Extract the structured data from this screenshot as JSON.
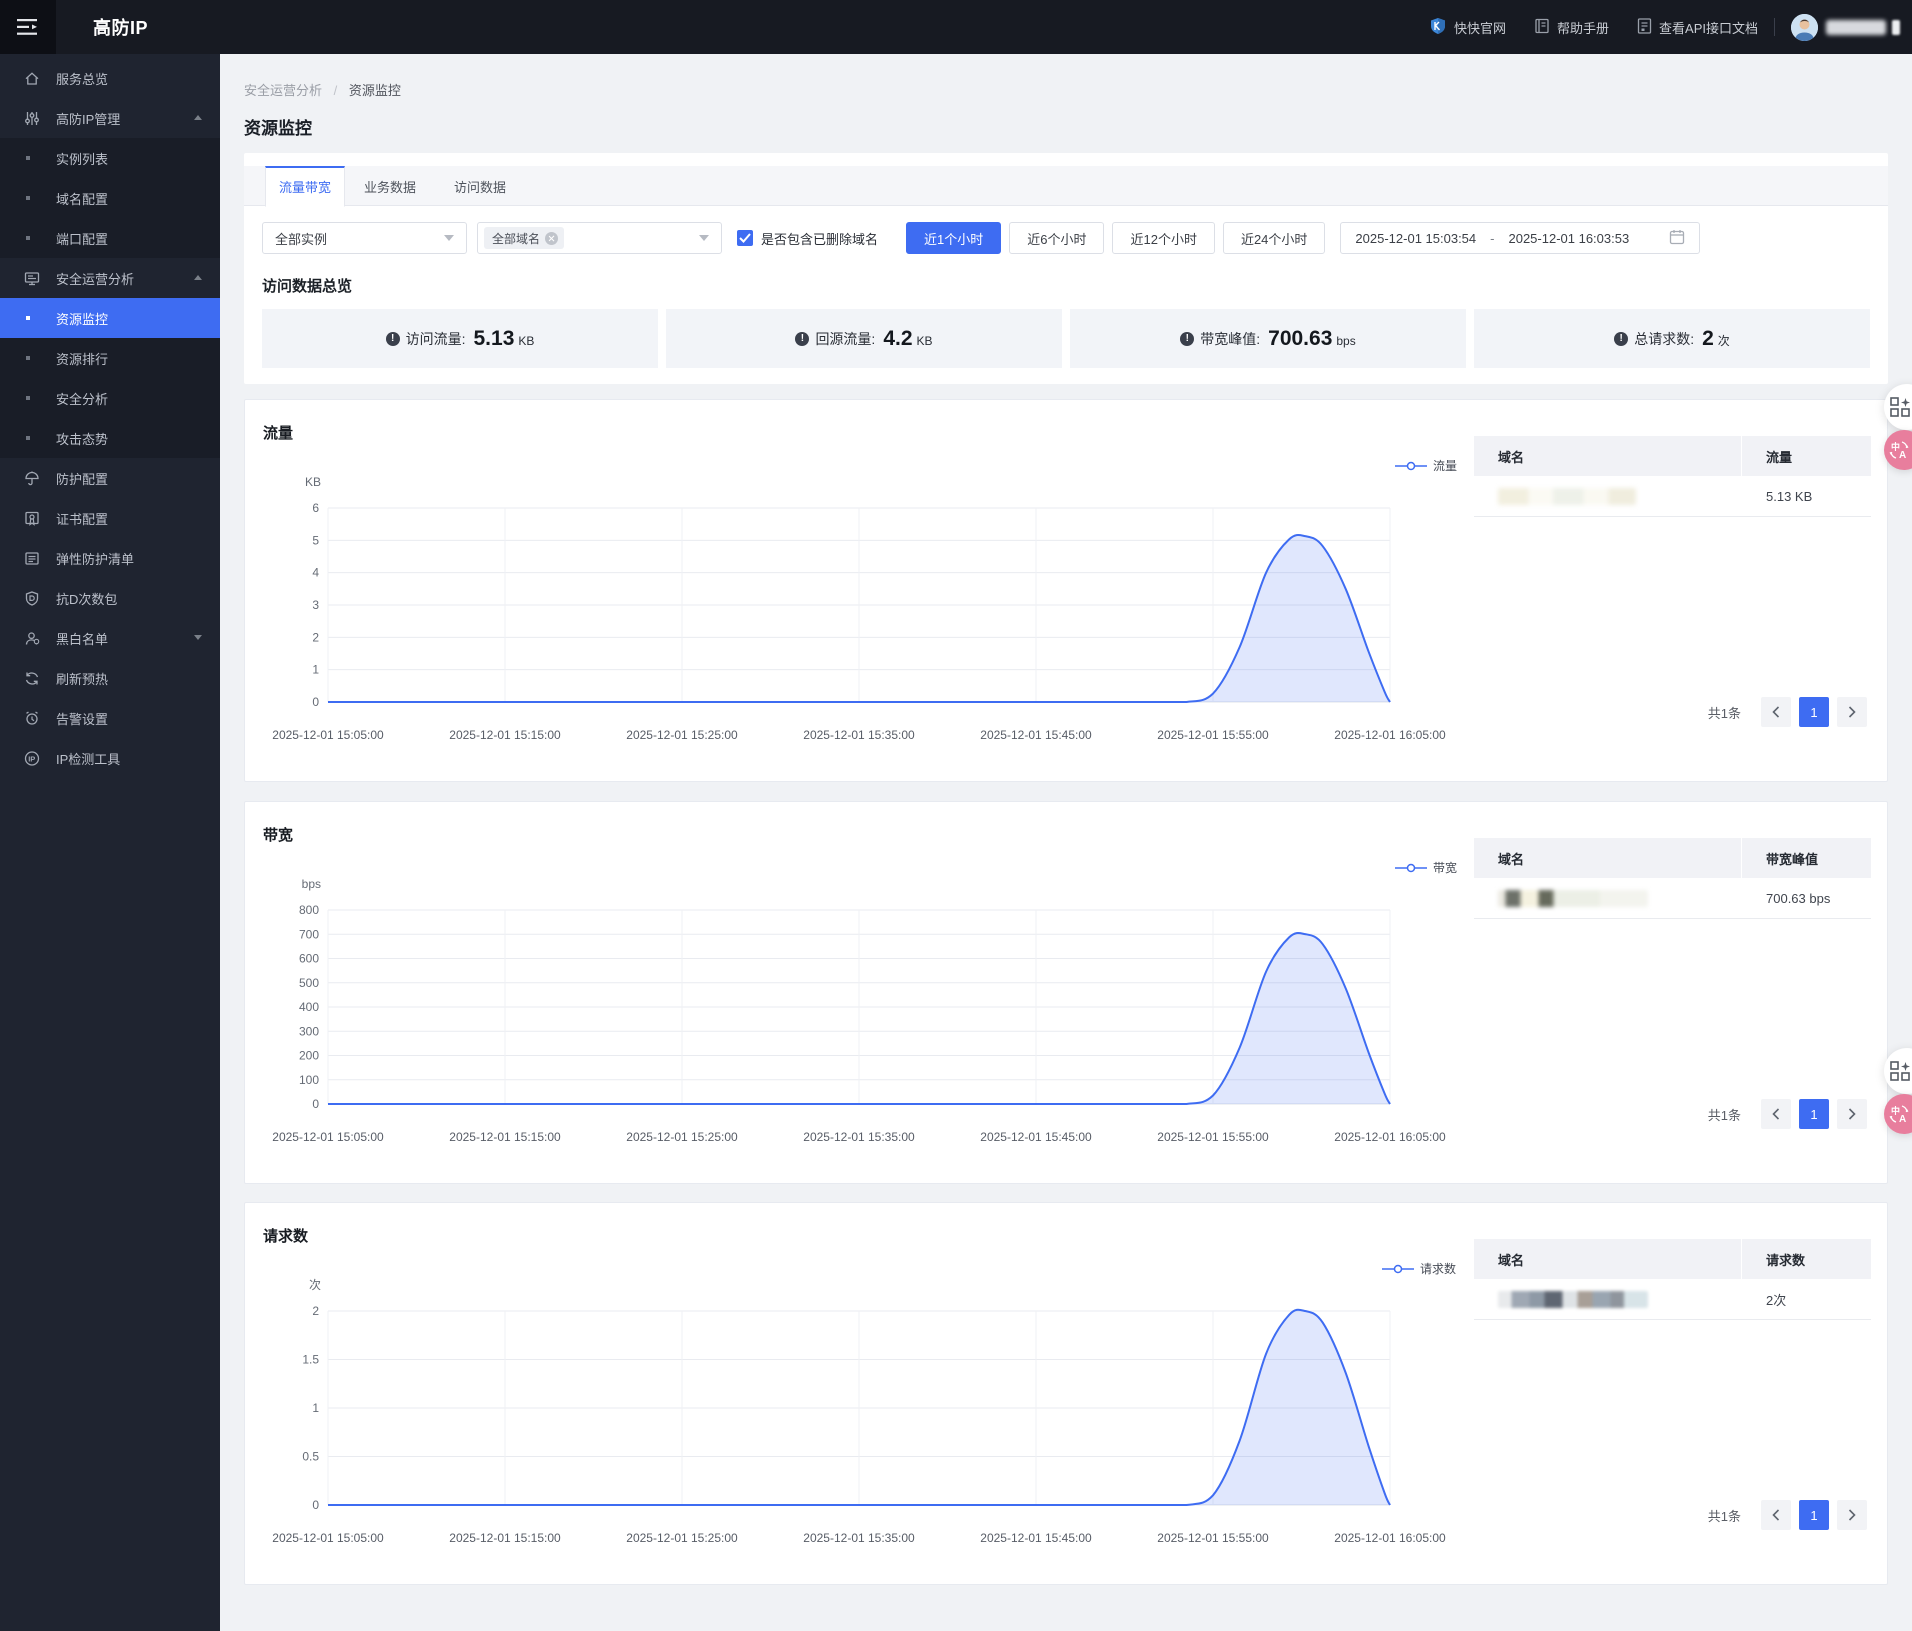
{
  "navbar": {
    "logo": "高防IP",
    "links": [
      {
        "id": "brand-site",
        "label": "快快官网",
        "icon": "brand-shield-icon"
      },
      {
        "id": "help-manual",
        "label": "帮助手册",
        "icon": "manual-icon"
      },
      {
        "id": "api-doc",
        "label": "查看API接口文档",
        "icon": "api-doc-icon"
      }
    ]
  },
  "sidebar": {
    "items": [
      {
        "id": "service-overview",
        "label": "服务总览",
        "icon": "home-icon",
        "type": "top"
      },
      {
        "id": "ip-manage",
        "label": "高防IP管理",
        "icon": "sliders-icon",
        "type": "group",
        "expanded": true
      },
      {
        "id": "instance-list",
        "label": "实例列表",
        "type": "sub"
      },
      {
        "id": "domain-config",
        "label": "域名配置",
        "type": "sub"
      },
      {
        "id": "port-config",
        "label": "端口配置",
        "type": "sub"
      },
      {
        "id": "security-operation",
        "label": "安全运营分析",
        "icon": "monitor-icon",
        "type": "group",
        "expanded": true
      },
      {
        "id": "resource-monitor",
        "label": "资源监控",
        "type": "sub",
        "active": true
      },
      {
        "id": "resource-rank",
        "label": "资源排行",
        "type": "sub"
      },
      {
        "id": "security-analysis",
        "label": "安全分析",
        "type": "sub"
      },
      {
        "id": "attack-situation",
        "label": "攻击态势",
        "type": "sub"
      },
      {
        "id": "protect-config",
        "label": "防护配置",
        "icon": "umbrella-icon",
        "type": "top"
      },
      {
        "id": "cert-config",
        "label": "证书配置",
        "icon": "certificate-icon",
        "type": "top"
      },
      {
        "id": "elastic-protect-list",
        "label": "弹性防护清单",
        "icon": "list-icon",
        "type": "top"
      },
      {
        "id": "anti-d-package",
        "label": "抗D次数包",
        "icon": "shield-icon",
        "type": "top"
      },
      {
        "id": "black-white-list",
        "label": "黑白名单",
        "icon": "user-icon",
        "type": "group",
        "expanded": false
      },
      {
        "id": "refresh-preheat",
        "label": "刷新预热",
        "icon": "refresh-icon",
        "type": "top"
      },
      {
        "id": "alert-settings",
        "label": "告警设置",
        "icon": "alarm-icon",
        "type": "top"
      },
      {
        "id": "ip-check-tool",
        "label": "IP检测工具",
        "icon": "ip-icon",
        "type": "top"
      }
    ]
  },
  "breadcrumb": {
    "parent": "安全运营分析",
    "separator": "/",
    "current": "资源监控"
  },
  "page_title": "资源监控",
  "tabs": [
    {
      "id": "traffic-bandwidth",
      "label": "流量带宽",
      "active": true
    },
    {
      "id": "business-data",
      "label": "业务数据",
      "active": false
    },
    {
      "id": "access-data",
      "label": "访问数据",
      "active": false
    }
  ],
  "filters": {
    "instance_select": "全部实例",
    "domain_select_tag": "全部域名",
    "include_deleted_label": "是否包含已删除域名",
    "include_deleted_checked": true,
    "time_ranges": [
      {
        "label": "近1个小时",
        "active": true
      },
      {
        "label": "近6个小时",
        "active": false
      },
      {
        "label": "近12个小时",
        "active": false
      },
      {
        "label": "近24个小时",
        "active": false
      }
    ],
    "date_start": "2025-12-01 15:03:54",
    "date_separator": "-",
    "date_end": "2025-12-01 16:03:53"
  },
  "overview": {
    "title": "访问数据总览",
    "stats": [
      {
        "label": "访问流量:",
        "value": "5.13",
        "unit": "KB"
      },
      {
        "label": "回源流量:",
        "value": "4.2",
        "unit": "KB"
      },
      {
        "label": "带宽峰值:",
        "value": "700.63",
        "unit": "bps"
      },
      {
        "label": "总请求数:",
        "value": "2",
        "unit": "次"
      }
    ]
  },
  "chart_data": [
    {
      "type": "area",
      "title": "流量",
      "unit": "KB",
      "legend": "流量",
      "ylim": [
        0,
        6
      ],
      "yticks": [
        0,
        1,
        2,
        3,
        4,
        5,
        6
      ],
      "x_range_minutes": 60,
      "x_labels": [
        "2025-12-01 15:05:00",
        "2025-12-01 15:15:00",
        "2025-12-01 15:25:00",
        "2025-12-01 15:35:00",
        "2025-12-01 15:45:00",
        "2025-12-01 15:55:00",
        "2025-12-01 16:05:00"
      ],
      "series": [
        {
          "name": "流量",
          "points": [
            [
              0,
              0
            ],
            [
              10,
              0
            ],
            [
              20,
              0
            ],
            [
              30,
              0
            ],
            [
              40,
              0
            ],
            [
              46,
              0
            ],
            [
              48.5,
              0
            ],
            [
              50,
              0.26
            ],
            [
              51.5,
              1.69
            ],
            [
              53,
              4.0
            ],
            [
              54.3,
              5.03
            ],
            [
              55.2,
              5.13
            ],
            [
              56.2,
              4.82
            ],
            [
              57.5,
              3.49
            ],
            [
              58.8,
              1.54
            ],
            [
              59.7,
              0.31
            ],
            [
              60,
              0
            ]
          ]
        }
      ],
      "grid": true,
      "legend_position": "top-right",
      "table": {
        "columns": [
          "域名",
          "流量"
        ],
        "rows": [
          {
            "domain_masked": true,
            "value": "5.13 KB"
          }
        ]
      },
      "pagination": {
        "total": "共1条",
        "page": "1"
      }
    },
    {
      "type": "area",
      "title": "带宽",
      "unit": "bps",
      "legend": "带宽",
      "ylim": [
        0,
        800
      ],
      "yticks": [
        0,
        100,
        200,
        300,
        400,
        500,
        600,
        700,
        800
      ],
      "x_range_minutes": 60,
      "x_labels": [
        "2025-12-01 15:05:00",
        "2025-12-01 15:15:00",
        "2025-12-01 15:25:00",
        "2025-12-01 15:35:00",
        "2025-12-01 15:45:00",
        "2025-12-01 15:55:00",
        "2025-12-01 16:05:00"
      ],
      "series": [
        {
          "name": "带宽",
          "points": [
            [
              0,
              0
            ],
            [
              10,
              0
            ],
            [
              20,
              0
            ],
            [
              30,
              0
            ],
            [
              40,
              0
            ],
            [
              46,
              0
            ],
            [
              48.5,
              0
            ],
            [
              50,
              35
            ],
            [
              51.5,
              231
            ],
            [
              53,
              546
            ],
            [
              54.3,
              687
            ],
            [
              55.2,
              700.63
            ],
            [
              56.2,
              659
            ],
            [
              57.5,
              476
            ],
            [
              58.8,
              210
            ],
            [
              59.7,
              42
            ],
            [
              60,
              0
            ]
          ]
        }
      ],
      "grid": true,
      "legend_position": "top-right",
      "table": {
        "columns": [
          "域名",
          "带宽峰值"
        ],
        "rows": [
          {
            "domain_masked": true,
            "value": "700.63 bps"
          }
        ]
      },
      "pagination": {
        "total": "共1条",
        "page": "1"
      }
    },
    {
      "type": "area",
      "title": "请求数",
      "unit": "次",
      "legend": "请求数",
      "ylim": [
        0,
        2
      ],
      "yticks": [
        0,
        0.5,
        1,
        1.5,
        2
      ],
      "x_range_minutes": 60,
      "x_labels": [
        "2025-12-01 15:05:00",
        "2025-12-01 15:15:00",
        "2025-12-01 15:25:00",
        "2025-12-01 15:35:00",
        "2025-12-01 15:45:00",
        "2025-12-01 15:55:00",
        "2025-12-01 16:05:00"
      ],
      "series": [
        {
          "name": "请求数",
          "points": [
            [
              0,
              0
            ],
            [
              10,
              0
            ],
            [
              20,
              0
            ],
            [
              30,
              0
            ],
            [
              40,
              0
            ],
            [
              46,
              0
            ],
            [
              48.5,
              0
            ],
            [
              50,
              0.1
            ],
            [
              51.5,
              0.66
            ],
            [
              53,
              1.56
            ],
            [
              54.3,
              1.96
            ],
            [
              55.2,
              2
            ],
            [
              56.2,
              1.88
            ],
            [
              57.5,
              1.36
            ],
            [
              58.8,
              0.6
            ],
            [
              59.7,
              0.12
            ],
            [
              60,
              0
            ]
          ]
        }
      ],
      "grid": true,
      "legend_position": "top-right",
      "table": {
        "columns": [
          "域名",
          "请求数"
        ],
        "rows": [
          {
            "domain_masked": true,
            "value": "2次"
          }
        ]
      },
      "pagination": {
        "total": "共1条",
        "page": "1"
      }
    }
  ],
  "floating_buttons": [
    {
      "icon": "screenshot-grid-icon"
    },
    {
      "icon": "translate-icon"
    }
  ]
}
